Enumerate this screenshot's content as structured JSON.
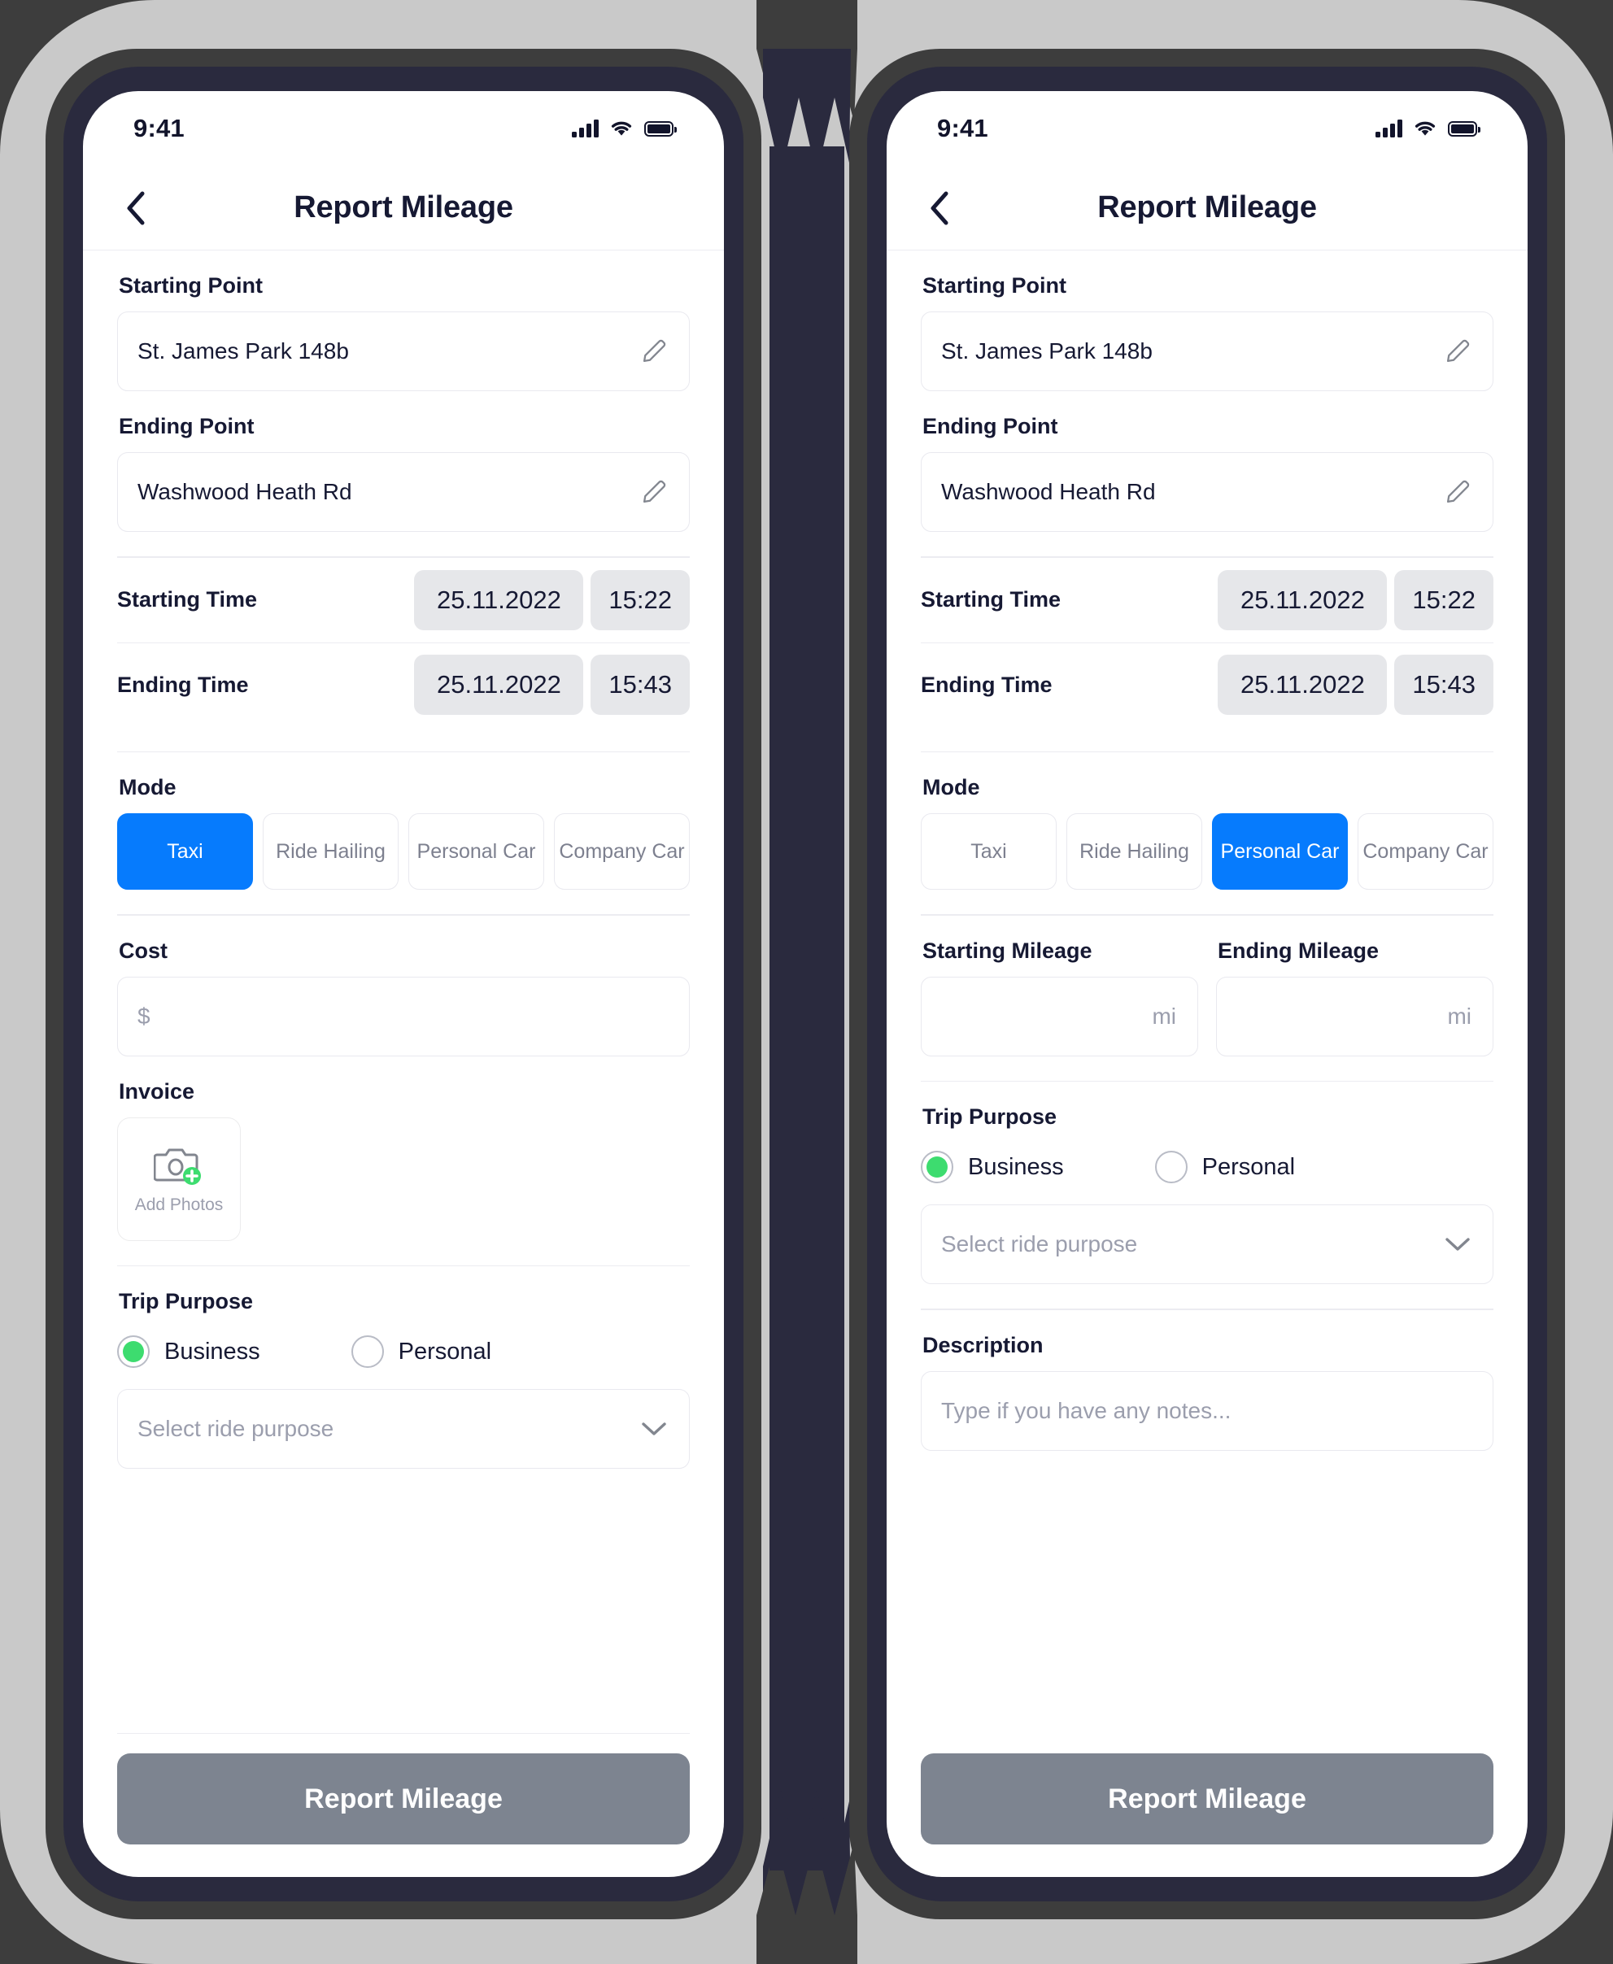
{
  "theme": {
    "accent_blue": "#067BFD",
    "accent_green": "#3DDC6F",
    "cta_gray": "#7D8490",
    "text_dark": "#161933",
    "text_muted": "#9B9EAD",
    "frame_dark": "#3D3D3D",
    "bezel_navy": "#2A2A3E",
    "plate_gray": "#C9C9C9"
  },
  "status_bar": {
    "time": "9:41",
    "cellular_icon": "signal-bars-icon",
    "wifi_icon": "wifi-icon",
    "battery_icon": "battery-full-icon"
  },
  "screens": [
    {
      "id": "taxi-variant",
      "nav": {
        "back_icon": "chevron-left-icon",
        "title": "Report Mileage"
      },
      "starting_point": {
        "label": "Starting Point",
        "value": "St. James Park 148b",
        "edit_icon": "pencil-icon"
      },
      "ending_point": {
        "label": "Ending Point",
        "value": "Washwood Heath Rd",
        "edit_icon": "pencil-icon"
      },
      "starting_time": {
        "label": "Starting Time",
        "date": "25.11.2022",
        "time": "15:22"
      },
      "ending_time": {
        "label": "Ending Time",
        "date": "25.11.2022",
        "time": "15:43"
      },
      "mode": {
        "label": "Mode",
        "options": [
          "Taxi",
          "Ride Hailing",
          "Personal Car",
          "Company Car"
        ],
        "selected": "Taxi"
      },
      "cost": {
        "label": "Cost",
        "placeholder": "$",
        "value": ""
      },
      "invoice": {
        "label": "Invoice",
        "add_photos_label": "Add Photos",
        "camera_icon": "camera-add-icon"
      },
      "trip_purpose": {
        "label": "Trip Purpose",
        "options": [
          "Business",
          "Personal"
        ],
        "selected": "Business",
        "select_placeholder": "Select ride purpose",
        "select_value": "",
        "chevron_icon": "chevron-down-icon"
      },
      "cta_label": "Report Mileage"
    },
    {
      "id": "personal-car-variant",
      "nav": {
        "back_icon": "chevron-left-icon",
        "title": "Report Mileage"
      },
      "starting_point": {
        "label": "Starting Point",
        "value": "St. James Park 148b",
        "edit_icon": "pencil-icon"
      },
      "ending_point": {
        "label": "Ending Point",
        "value": "Washwood Heath Rd",
        "edit_icon": "pencil-icon"
      },
      "starting_time": {
        "label": "Starting Time",
        "date": "25.11.2022",
        "time": "15:22"
      },
      "ending_time": {
        "label": "Ending Time",
        "date": "25.11.2022",
        "time": "15:43"
      },
      "mode": {
        "label": "Mode",
        "options": [
          "Taxi",
          "Ride Hailing",
          "Personal Car",
          "Company Car"
        ],
        "selected": "Personal Car"
      },
      "starting_mileage": {
        "label": "Starting Mileage",
        "value": "",
        "unit": "mi"
      },
      "ending_mileage": {
        "label": "Ending Mileage",
        "value": "",
        "unit": "mi"
      },
      "trip_purpose": {
        "label": "Trip Purpose",
        "options": [
          "Business",
          "Personal"
        ],
        "selected": "Business",
        "select_placeholder": "Select ride purpose",
        "select_value": "",
        "chevron_icon": "chevron-down-icon"
      },
      "description": {
        "label": "Description",
        "placeholder": "Type if you have any notes...",
        "value": ""
      },
      "cta_label": "Report Mileage"
    }
  ]
}
